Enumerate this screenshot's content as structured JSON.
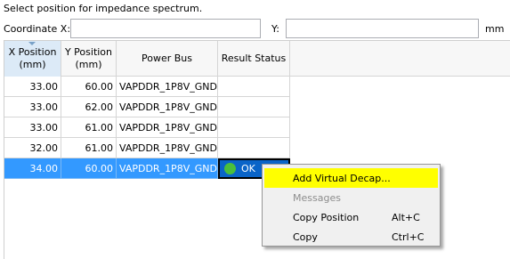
{
  "instruction": "Select position for impedance spectrum.",
  "coordinate": {
    "label": "Coordinate  X:",
    "x_value": "",
    "y_label": "Y:",
    "y_value": "",
    "unit": "mm"
  },
  "table": {
    "headers": [
      "X Position\n(mm)",
      "Y Position\n(mm)",
      "Power Bus",
      "Result Status"
    ],
    "rows": [
      {
        "x": "33.00",
        "y": "60.00",
        "bus": "VAPDDR_1P8V_GND",
        "status": ""
      },
      {
        "x": "33.00",
        "y": "62.00",
        "bus": "VAPDDR_1P8V_GND",
        "status": ""
      },
      {
        "x": "33.00",
        "y": "61.00",
        "bus": "VAPDDR_1P8V_GND",
        "status": ""
      },
      {
        "x": "32.00",
        "y": "61.00",
        "bus": "VAPDDR_1P8V_GND",
        "status": ""
      },
      {
        "x": "34.00",
        "y": "60.00",
        "bus": "VAPDDR_1P8V_GND",
        "status": "OK"
      }
    ],
    "selected_row": 4
  },
  "context_menu": {
    "items": [
      {
        "label": "Add Virtual Decap...",
        "shortcut": "",
        "highlighted": true,
        "enabled": true
      },
      {
        "label": "Messages",
        "shortcut": "",
        "highlighted": false,
        "enabled": false
      },
      {
        "label": "Copy Position",
        "shortcut": "Alt+C",
        "highlighted": false,
        "enabled": true
      },
      {
        "label": "Copy",
        "shortcut": "Ctrl+C",
        "highlighted": false,
        "enabled": true
      }
    ]
  },
  "colors": {
    "selection": "#3399ff",
    "menu_highlight": "#ffff00",
    "status_ok": "#4bbf3c"
  }
}
